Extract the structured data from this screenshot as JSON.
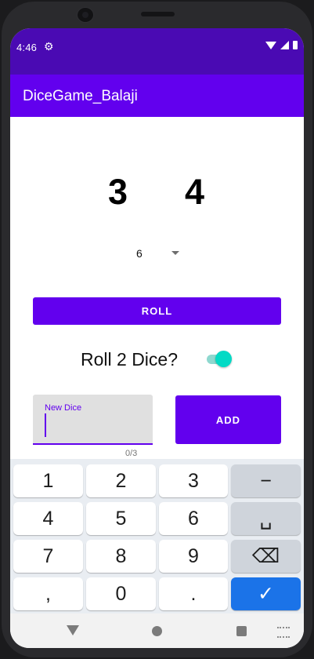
{
  "status": {
    "time": "4:46"
  },
  "app": {
    "title": "DiceGame_Balaji"
  },
  "dice": {
    "die1": "3",
    "die2": "4"
  },
  "spinner": {
    "selected": "6"
  },
  "roll": {
    "label": "ROLL"
  },
  "toggle": {
    "label": "Roll 2 Dice?",
    "checked": true
  },
  "new_dice": {
    "label": "New Dice",
    "value": "",
    "counter": "0/3"
  },
  "add": {
    "label": "ADD"
  },
  "keyboard": {
    "rows": [
      [
        "1",
        "2",
        "3",
        "−"
      ],
      [
        "4",
        "5",
        "6",
        "␣"
      ],
      [
        "7",
        "8",
        "9",
        "⌫"
      ],
      [
        ",",
        "0",
        ".",
        "✓"
      ]
    ]
  }
}
